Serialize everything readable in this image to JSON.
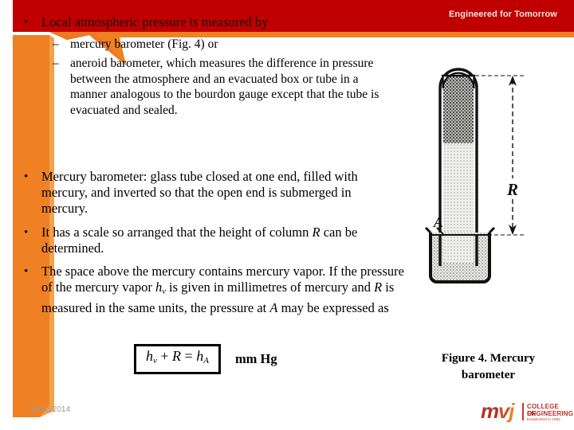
{
  "header": {
    "tagline": "Engineered for Tomorrow",
    "band_color": "#c00000",
    "accent_color": "#ef8023"
  },
  "content": {
    "bullet1": {
      "marker": "•",
      "text": "Local atmospheric pressure is measured by"
    },
    "sub_bullets": [
      {
        "marker": "–",
        "text": "mercury barometer (Fig. 4) or"
      },
      {
        "marker": "–",
        "text": "aneroid barometer, which measures the difference in pressure between the atmosphere and an evacuated box or tube in a manner analogous to the bourdon gauge except that the tube is evacuated and sealed."
      }
    ],
    "bullet2": {
      "marker": "•",
      "text": "Mercury barometer: glass tube closed at one end, filled with mercury, and inverted so that the open end is submerged in mercury."
    },
    "bullet3": {
      "marker": "•",
      "text_before": "It has a scale so arranged that the height of column ",
      "symbol": "R",
      "text_after": " can be determined."
    },
    "bullet4": {
      "marker": "•",
      "part1": "The space above the mercury contains mercury vapor. If the pressure of the mercury vapor ",
      "sym1": "h",
      "sym1_sub": "v",
      "part2": " is given in millimetres of mercury and ",
      "sym2": "R",
      "part3": " is measured in the same units, the pressure at ",
      "sym3": "A",
      "part4": " may be expressed as"
    }
  },
  "equation": {
    "h1": "h",
    "h1_sub": "v",
    "plus": "+",
    "R": "R",
    "equals": "=",
    "h2": "h",
    "h2_sub": "A",
    "units": "mm Hg"
  },
  "figure": {
    "caption_line1": "Figure 4.  Mercury",
    "caption_line2": "barometer",
    "label_R": "R",
    "label_A": "A"
  },
  "footer": {
    "date": "08/22/2014",
    "logo": {
      "m": "m",
      "v": "v",
      "j": "j",
      "line1": "COLLEGE OF",
      "line2": "ENGINEERING",
      "line3": "Established in 1982"
    }
  }
}
